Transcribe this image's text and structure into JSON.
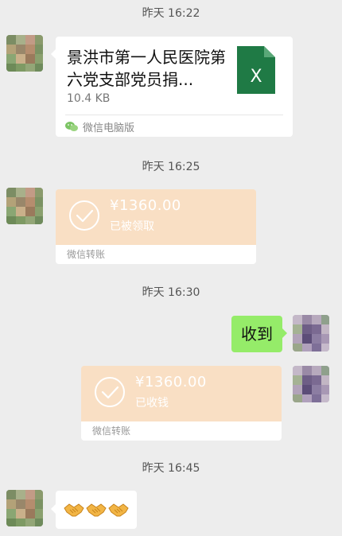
{
  "chat": {
    "timestamps": [
      "昨天 16:22",
      "昨天 16:25",
      "昨天 16:30",
      "昨天 16:45"
    ],
    "file_message": {
      "name": "景洪市第一人民医院第六党支部党员捐...",
      "size": "10.4 KB",
      "source": "微信电脑版",
      "icon": "excel-file-icon",
      "icon_letter": "X",
      "icon_color": "#1f7a45"
    },
    "transfer_received_by_them": {
      "amount": "¥1360.00",
      "status": "已被领取",
      "footer": "微信转账"
    },
    "text_message_self": {
      "text": "收到"
    },
    "transfer_received_by_me": {
      "amount": "¥1360.00",
      "status": "已收钱",
      "footer": "微信转账"
    },
    "emoji_message": {
      "emojis": [
        "handshake",
        "handshake",
        "handshake"
      ]
    }
  },
  "colors": {
    "background": "#ededed",
    "self_bubble": "#95ec69",
    "transfer_bg": "#f9dfc4",
    "white": "#ffffff"
  }
}
